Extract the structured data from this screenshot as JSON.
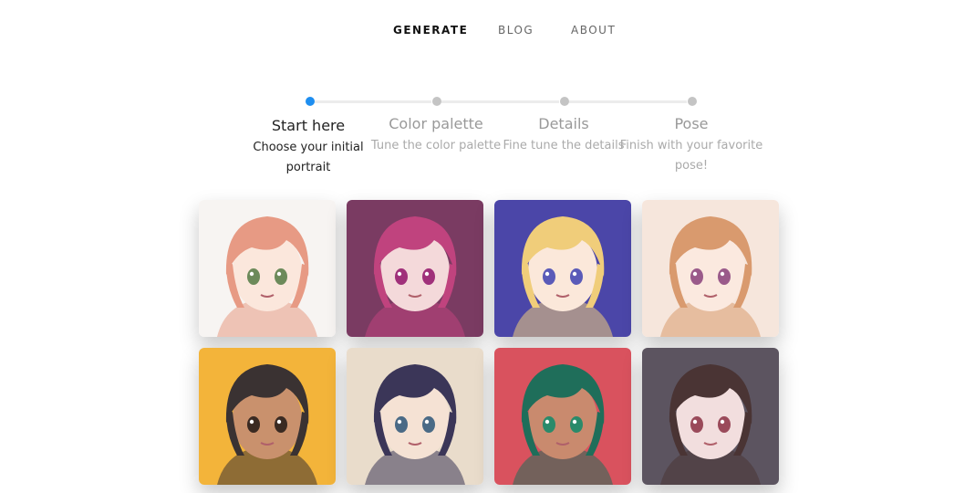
{
  "nav": {
    "items": [
      {
        "label": "GENERATE",
        "active": true
      },
      {
        "label": "BLOG",
        "active": false
      },
      {
        "label": "ABOUT",
        "active": false
      }
    ]
  },
  "steps": [
    {
      "title": "Start here",
      "description": "Choose your initial portrait",
      "active": true
    },
    {
      "title": "Color palette",
      "description": "Tune the color palette",
      "active": false
    },
    {
      "title": "Details",
      "description": "Fine tune the details",
      "active": false
    },
    {
      "title": "Pose",
      "description": "Finish with your favorite pose!",
      "active": false
    }
  ],
  "colors": {
    "accent": "#1e8ef0",
    "inactive_dot": "#c4c4c4",
    "line": "#ececec"
  },
  "portraits": [
    {
      "bg": "#f7f4f2",
      "hair": "#e79a84",
      "eyes": "#6c8a5a",
      "skin": "#fbe7dc"
    },
    {
      "bg": "#7a3b62",
      "hair": "#c0437e",
      "eyes": "#a0307a",
      "skin": "#f4d9da"
    },
    {
      "bg": "#4b46a8",
      "hair": "#f0cd7a",
      "eyes": "#5a5ab8",
      "skin": "#fbe8da"
    },
    {
      "bg": "#f6e6dc",
      "hair": "#d99a6e",
      "eyes": "#9a5a8a",
      "skin": "#fbe9df"
    },
    {
      "bg": "#f3b43a",
      "hair": "#3a3232",
      "eyes": "#3a2a22",
      "skin": "#c9916d"
    },
    {
      "bg": "#e9dccb",
      "hair": "#3b3658",
      "eyes": "#4a6a86",
      "skin": "#f5e2d4"
    },
    {
      "bg": "#d9525e",
      "hair": "#1f6e5a",
      "eyes": "#2a8a6a",
      "skin": "#c98a6e"
    },
    {
      "bg": "#5c5460",
      "hair": "#4a3434",
      "eyes": "#9a4a5a",
      "skin": "#f2dede"
    }
  ]
}
